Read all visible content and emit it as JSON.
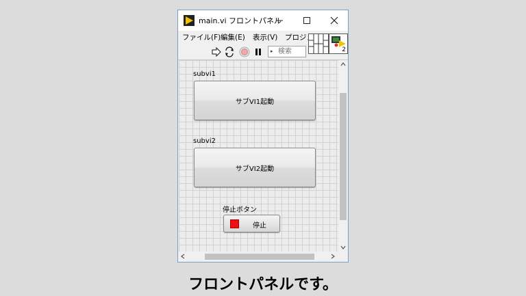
{
  "window": {
    "title": "main.vi フロントパネル",
    "minimize": "—",
    "maximize": "☐",
    "close": "✕"
  },
  "menu": {
    "items": [
      "ファイル(F)",
      "編集(E)",
      "表示(V)",
      "プロジェ"
    ]
  },
  "toolbar": {
    "search_placeholder": "検索",
    "vi_icon_number": "2"
  },
  "panel": {
    "subvi1_label": "subvi1",
    "subvi1_button": "サブVI1起動",
    "subvi2_label": "subvi2",
    "subvi2_button": "サブVI2起動",
    "stop_label": "停止ボタン",
    "stop_button": "停止"
  },
  "caption": "フロントパネルです。",
  "colors": {
    "stop_indicator": "#ee1111",
    "window_border": "#7a9ec4",
    "app_icon": "#f5c000"
  }
}
